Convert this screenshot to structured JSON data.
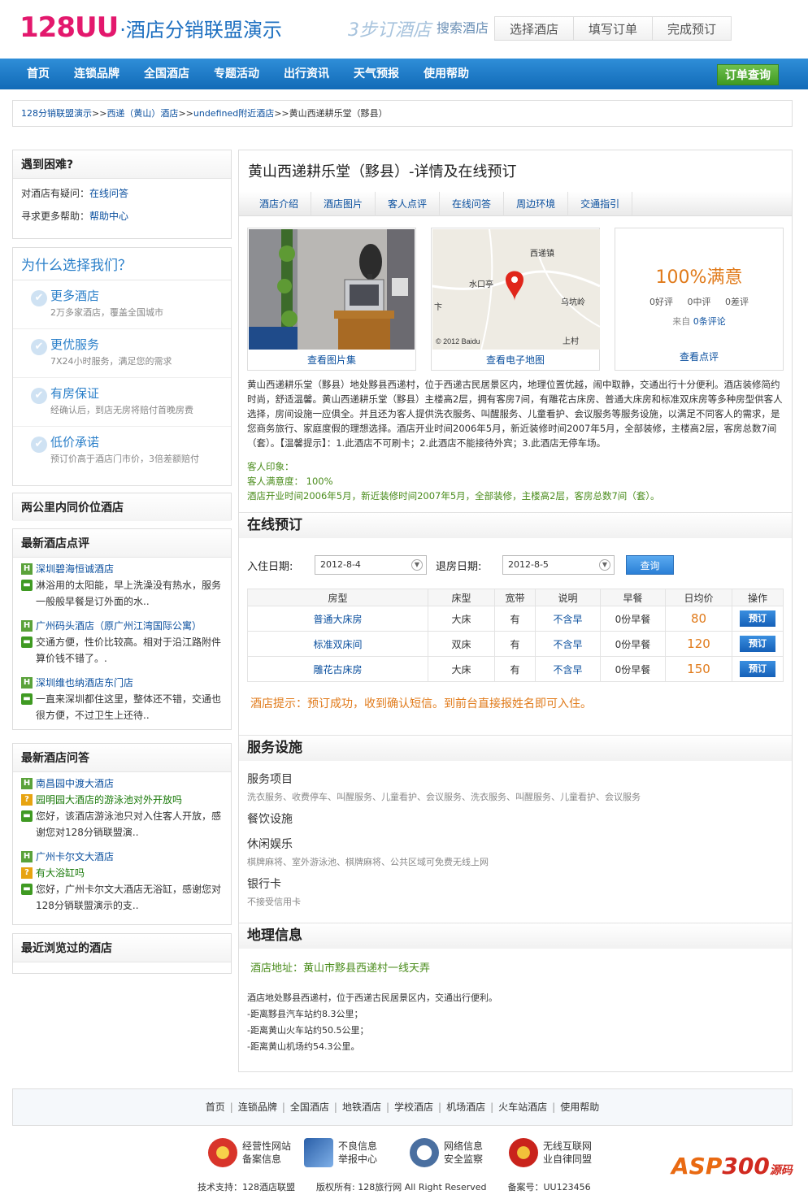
{
  "header": {
    "logo_num": "128UU",
    "logo_text": "·酒店分销联盟演示",
    "steps_label": "3步订酒店",
    "steps": [
      "搜索酒店",
      "选择酒店",
      "填写订单",
      "完成预订"
    ]
  },
  "nav": {
    "items": [
      "首页",
      "连锁品牌",
      "全国酒店",
      "专题活动",
      "出行资讯",
      "天气预报",
      "使用帮助"
    ],
    "order_button": "订单查询"
  },
  "breadcrumb": {
    "links": [
      "128分销联盟演示",
      "西递（黄山）酒店",
      "undefined附近酒店"
    ],
    "sep": ">>",
    "current": "黄山西递耕乐堂（黟县）"
  },
  "sidebar": {
    "help": {
      "title": "遇到困难?",
      "rows": [
        {
          "label": "对酒店有疑问：",
          "link": "在线问答"
        },
        {
          "label": "寻求更多帮助：",
          "link": "帮助中心"
        }
      ]
    },
    "why": {
      "title": "为什么选择我们？",
      "items": [
        {
          "title": "更多酒店",
          "desc": "2万多家酒店，覆盖全国城市"
        },
        {
          "title": "更优服务",
          "desc": "7X24小时服务，满足您的需求"
        },
        {
          "title": "有房保证",
          "desc": "经确认后，到店无房将赔付首晚房费"
        },
        {
          "title": "低价承诺",
          "desc": "预订价高于酒店门市价，3倍差额赔付"
        }
      ]
    },
    "nearby": {
      "title": "两公里内同价位酒店"
    },
    "reviews": {
      "title": "最新酒店点评",
      "items": [
        {
          "hotel": "深圳碧海恒诚酒店",
          "comment_l1": "淋浴用的太阳能，早上洗澡没有热水，服务",
          "comment_l2": "一般般早餐是订外面的水.."
        },
        {
          "hotel": "广州码头酒店（原广州江湾国际公寓）",
          "comment_l1": "交通方便，性价比较高。相对于沿江路附件",
          "comment_l2": "算价钱不错了。."
        },
        {
          "hotel": "深圳维也纳酒店东门店",
          "comment_l1": "一直来深圳都住这里，整体还不错，交通也",
          "comment_l2": "很方便，不过卫生上还待.."
        }
      ]
    },
    "qa": {
      "title": "最新酒店问答",
      "items": [
        {
          "hotel": "南昌园中渡大酒店",
          "question": "园明园大酒店的游泳池对外开放吗",
          "answer_l1": "您好，该酒店游泳池只对入住客人开放，感",
          "answer_l2": "谢您对128分销联盟演.."
        },
        {
          "hotel": "广州卡尔文大酒店",
          "question": "有大浴缸吗",
          "answer_l1": "您好，广州卡尔文大酒店无浴缸，感谢您对",
          "answer_l2": "128分销联盟演示的支.."
        }
      ]
    },
    "recent": {
      "title": "最近浏览过的酒店"
    }
  },
  "hotel": {
    "title": "黄山西递耕乐堂（黟县）-详情及在线预订",
    "tabs": [
      "酒店介绍",
      "酒店图片",
      "客人点评",
      "在线问答",
      "周边环境",
      "交通指引"
    ],
    "photo_caption": "查看图片集",
    "map_caption": "查看电子地图",
    "map_labels": [
      "西递镇",
      "水口亭",
      "乌坑岭",
      "上村",
      "© 2012 Baidu",
      "卞"
    ],
    "satisfaction": "100%满意",
    "good": "0好评",
    "mid": "0中评",
    "bad": "0差评",
    "from": "来自",
    "count": "0条评论",
    "review_caption": "查看点评",
    "description": "黄山西递耕乐堂（黟县）地处黟县西递村，位于西递古民居景区内，地理位置优越，闹中取静，交通出行十分便利。酒店装修简约时尚，舒适温馨。黄山西递耕乐堂（黟县）主楼高2层，拥有客房7间，有雕花古床房、普通大床房和标准双床房等多种房型供客人选择，房间设施一应俱全。并且还为客人提供洗衣服务、叫醒服务、儿童看护、会议服务等服务设施，以满足不同客人的需求，是您商务旅行、家庭度假的理想选择。酒店开业时间2006年5月，新近装修时间2007年5月，全部装修，主楼高2层，客房总数7间（套）。【温馨提示】：1.此酒店不可刷卡；2.此酒店不能接待外宾；3.此酒店无停车场。",
    "impression_label": "客人印象：",
    "satisfaction_line": "客人满意度： 100%",
    "open_line": "酒店开业时间2006年5月，新近装修时间2007年5月，全部装修，主楼高2层，客房总数7间（套）。"
  },
  "booking": {
    "title": "在线预订",
    "checkin_label": "入住日期:",
    "checkin": "2012-8-4",
    "checkout_label": "退房日期:",
    "checkout": "2012-8-5",
    "query": "查询",
    "columns": [
      "房型",
      "床型",
      "宽带",
      "说明",
      "早餐",
      "日均价",
      "操作"
    ],
    "rooms": [
      {
        "type": "普通大床房",
        "bed": "大床",
        "net": "有",
        "note": "不含早",
        "breakfast": "0份早餐",
        "price": "80",
        "action": "预订"
      },
      {
        "type": "标准双床间",
        "bed": "双床",
        "net": "有",
        "note": "不含早",
        "breakfast": "0份早餐",
        "price": "120",
        "action": "预订"
      },
      {
        "type": "雕花古床房",
        "bed": "大床",
        "net": "有",
        "note": "不含早",
        "breakfast": "0份早餐",
        "price": "150",
        "action": "预订"
      }
    ],
    "tip": "酒店提示：预订成功，收到确认短信。到前台直接报姓名即可入住。"
  },
  "services": {
    "title": "服务设施",
    "items": [
      {
        "head": "服务项目",
        "value": "洗衣服务、收费停车、叫醒服务、儿童看护、会议服务、洗衣服务、叫醒服务、儿童看护、会议服务"
      },
      {
        "head": "餐饮设施",
        "value": ""
      },
      {
        "head": "休闲娱乐",
        "value": "棋牌麻将、室外游泳池、棋牌麻将、公共区域可免费无线上网"
      },
      {
        "head": "银行卡",
        "value": "不接受信用卡"
      }
    ]
  },
  "geo": {
    "title": "地理信息",
    "address": "酒店地址：黄山市黟县西递村一线天弄",
    "lines": [
      "酒店地处黟县西递村，位于西递古民居景区内，交通出行便利。",
      "-距离黟县汽车站约8.3公里；",
      "-距离黄山火车站约50.5公里；",
      "-距离黄山机场约54.3公里。"
    ]
  },
  "footer": {
    "links": [
      "首页",
      "连锁品牌",
      "全国酒店",
      "地铁酒店",
      "学校酒店",
      "机场酒店",
      "火车站酒店",
      "使用帮助"
    ],
    "badges": [
      {
        "l1": "经营性网站",
        "l2": "备案信息",
        "color": "#d8342a"
      },
      {
        "l1": "不良信息",
        "l2": "举报中心",
        "color": "#2a5fa8"
      },
      {
        "l1": "网络信息",
        "l2": "安全监察",
        "color": "#4a6fa0"
      },
      {
        "l1": "无线互联网",
        "l2": "业自律同盟",
        "color": "#c9231c"
      }
    ],
    "support": "技术支持：128酒店联盟",
    "copyright": "版权所有: 128旅行网 All Right Reserved",
    "record": "备案号：UU123456",
    "watermark_a": "ASP",
    "watermark_b": "300",
    "watermark_c": "源码"
  },
  "colors": {
    "accent": "#1c6fc0",
    "brand_pink": "#e3186d",
    "price": "#e07a1a",
    "green": "#4a8c1c"
  }
}
